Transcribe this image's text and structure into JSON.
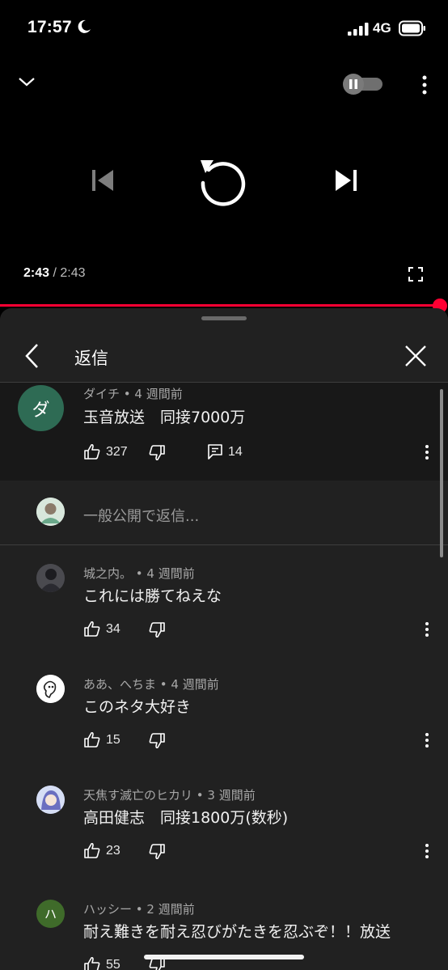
{
  "status_bar": {
    "time": "17:57",
    "network": "4G"
  },
  "player": {
    "current_time": "2:43",
    "separator": "/",
    "duration": "2:43",
    "progress_fraction": 1.0,
    "autoplay_on": false
  },
  "panel": {
    "title": "返信",
    "reply_placeholder": "一般公開で返信..."
  },
  "parent_comment": {
    "avatar_letter": "ダ",
    "avatar_color": "#2e6b54",
    "meta": "ダイチ • 4 週間前",
    "text": "玉音放送　同接7000万",
    "likes": "327",
    "replies": "14"
  },
  "replies": [
    {
      "meta": "城之内。 • 4 週間前",
      "text": "これには勝てねえな",
      "likes": "34"
    },
    {
      "meta": "ああ、へちま • 4 週間前",
      "text": "このネタ大好き",
      "likes": "15"
    },
    {
      "meta": "天焦す滅亡のヒカリ • 3 週間前",
      "text": "高田健志　同接1800万(数秒)",
      "likes": "23"
    },
    {
      "meta": "ハッシー • 2 週間前",
      "text": "耐え難きを耐え忍びがたきを忍ぶぞ！！放送",
      "likes": "55",
      "avatar_letter": "ハ",
      "avatar_color": "#3f6b2a"
    }
  ]
}
